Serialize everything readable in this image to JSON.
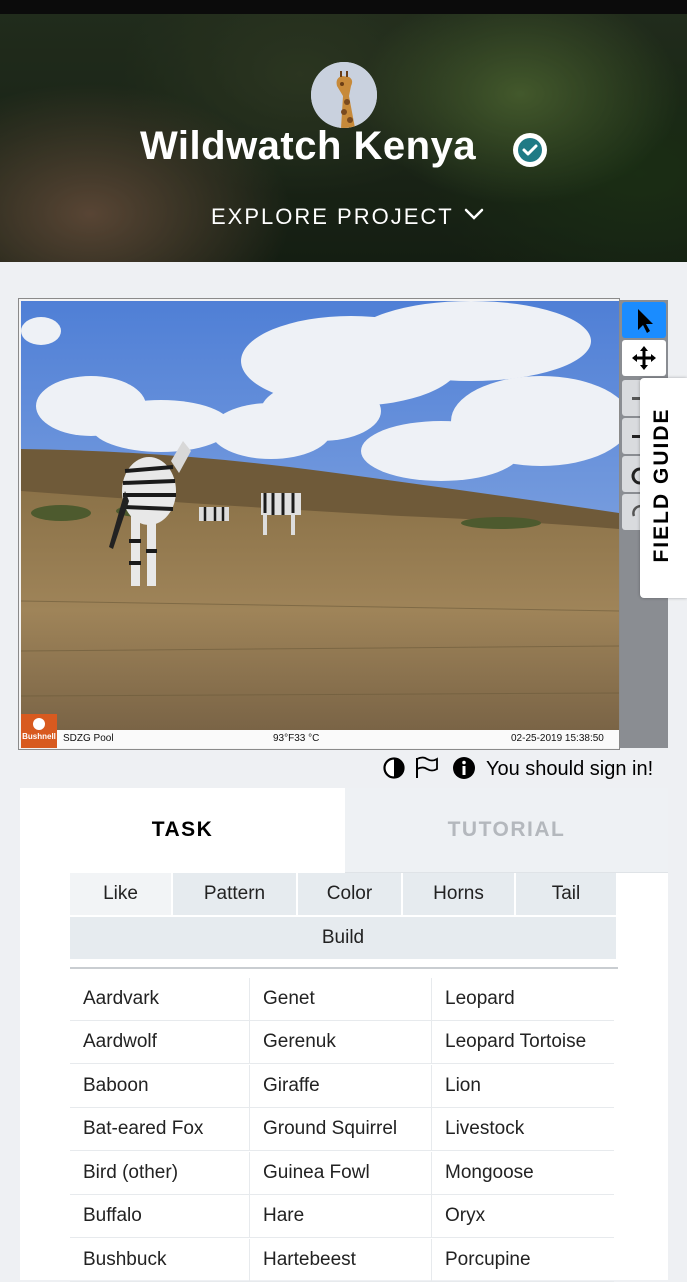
{
  "project": {
    "title": "Wildwatch Kenya",
    "explore_label": "EXPLORE PROJECT",
    "avatar_icon": "giraffe-avatar",
    "verified_icon": "check-badge-icon"
  },
  "viewer": {
    "camera_brand": "Bushnell",
    "location": "SDZG Pool",
    "temperature": "93°F33 °C",
    "timestamp": "02-25-2019 15:38:50",
    "tools": [
      "pointer-icon",
      "move-icon",
      "zoom-in-icon",
      "zoom-out-icon",
      "reset-icon",
      "rotate-icon"
    ],
    "field_guide_label": "FIELD GUIDE"
  },
  "meta": {
    "signin_text": "You should sign in!",
    "icons": [
      "invert-icon",
      "flag-icon",
      "info-icon"
    ]
  },
  "tabs": {
    "task": "TASK",
    "tutorial": "TUTORIAL"
  },
  "filters": [
    "Like",
    "Pattern",
    "Color",
    "Horns",
    "Tail",
    "Build"
  ],
  "species": [
    [
      "Aardvark",
      "Genet",
      "Leopard"
    ],
    [
      "Aardwolf",
      "Gerenuk",
      "Leopard Tortoise"
    ],
    [
      "Baboon",
      "Giraffe",
      "Lion"
    ],
    [
      "Bat-eared Fox",
      "Ground Squirrel",
      "Livestock"
    ],
    [
      "Bird (other)",
      "Guinea Fowl",
      "Mongoose"
    ],
    [
      "Buffalo",
      "Hare",
      "Oryx"
    ],
    [
      "Bushbuck",
      "Hartebeest",
      "Porcupine"
    ]
  ],
  "colors": {
    "accent": "#1a8cff",
    "verified": "#1f7a85"
  }
}
